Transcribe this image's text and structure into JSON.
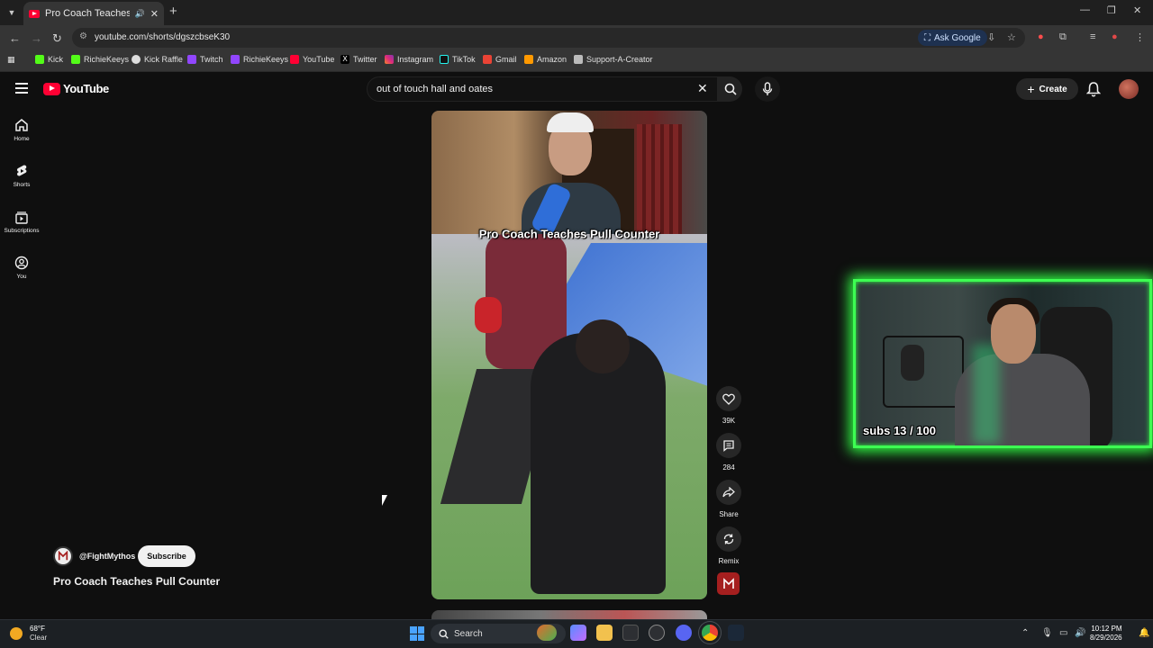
{
  "browser": {
    "tab_title": "Pro Coach Teaches Pull Counter",
    "url": "youtube.com/shorts/dgszcbseK30",
    "ask_google": "Ask Google",
    "bookmarks": [
      "Kick",
      "RichieKeeys",
      "Kick Raffle",
      "Twitch",
      "RichieKeeys",
      "YouTube",
      "Twitter",
      "Instagram",
      "TikTok",
      "Gmail",
      "Amazon",
      "Support-A-Creator"
    ]
  },
  "youtube": {
    "logo_text": "YouTube",
    "search_query": "out of touch hall and oates",
    "create_label": "Create",
    "nav": [
      {
        "label": "Home",
        "icon": "home-icon"
      },
      {
        "label": "Shorts",
        "icon": "shorts-icon"
      },
      {
        "label": "Subscriptions",
        "icon": "subscriptions-icon"
      },
      {
        "label": "You",
        "icon": "you-icon"
      }
    ]
  },
  "short": {
    "overlay_title": "Pro Coach Teaches Pull Counter",
    "title": "Pro Coach Teaches Pull Counter",
    "channel": "@FightMythos",
    "subscribe_label": "Subscribe",
    "likes": "39K",
    "comments": "284",
    "share_label": "Share",
    "remix_label": "Remix"
  },
  "stream_overlay": {
    "subs_text": "subs 13 / 100",
    "accent_color": "#3dff52"
  },
  "taskbar": {
    "temperature": "68°F",
    "condition": "Clear",
    "search_label": "Search",
    "time": "10:12 PM",
    "date": "8/29/2026"
  }
}
